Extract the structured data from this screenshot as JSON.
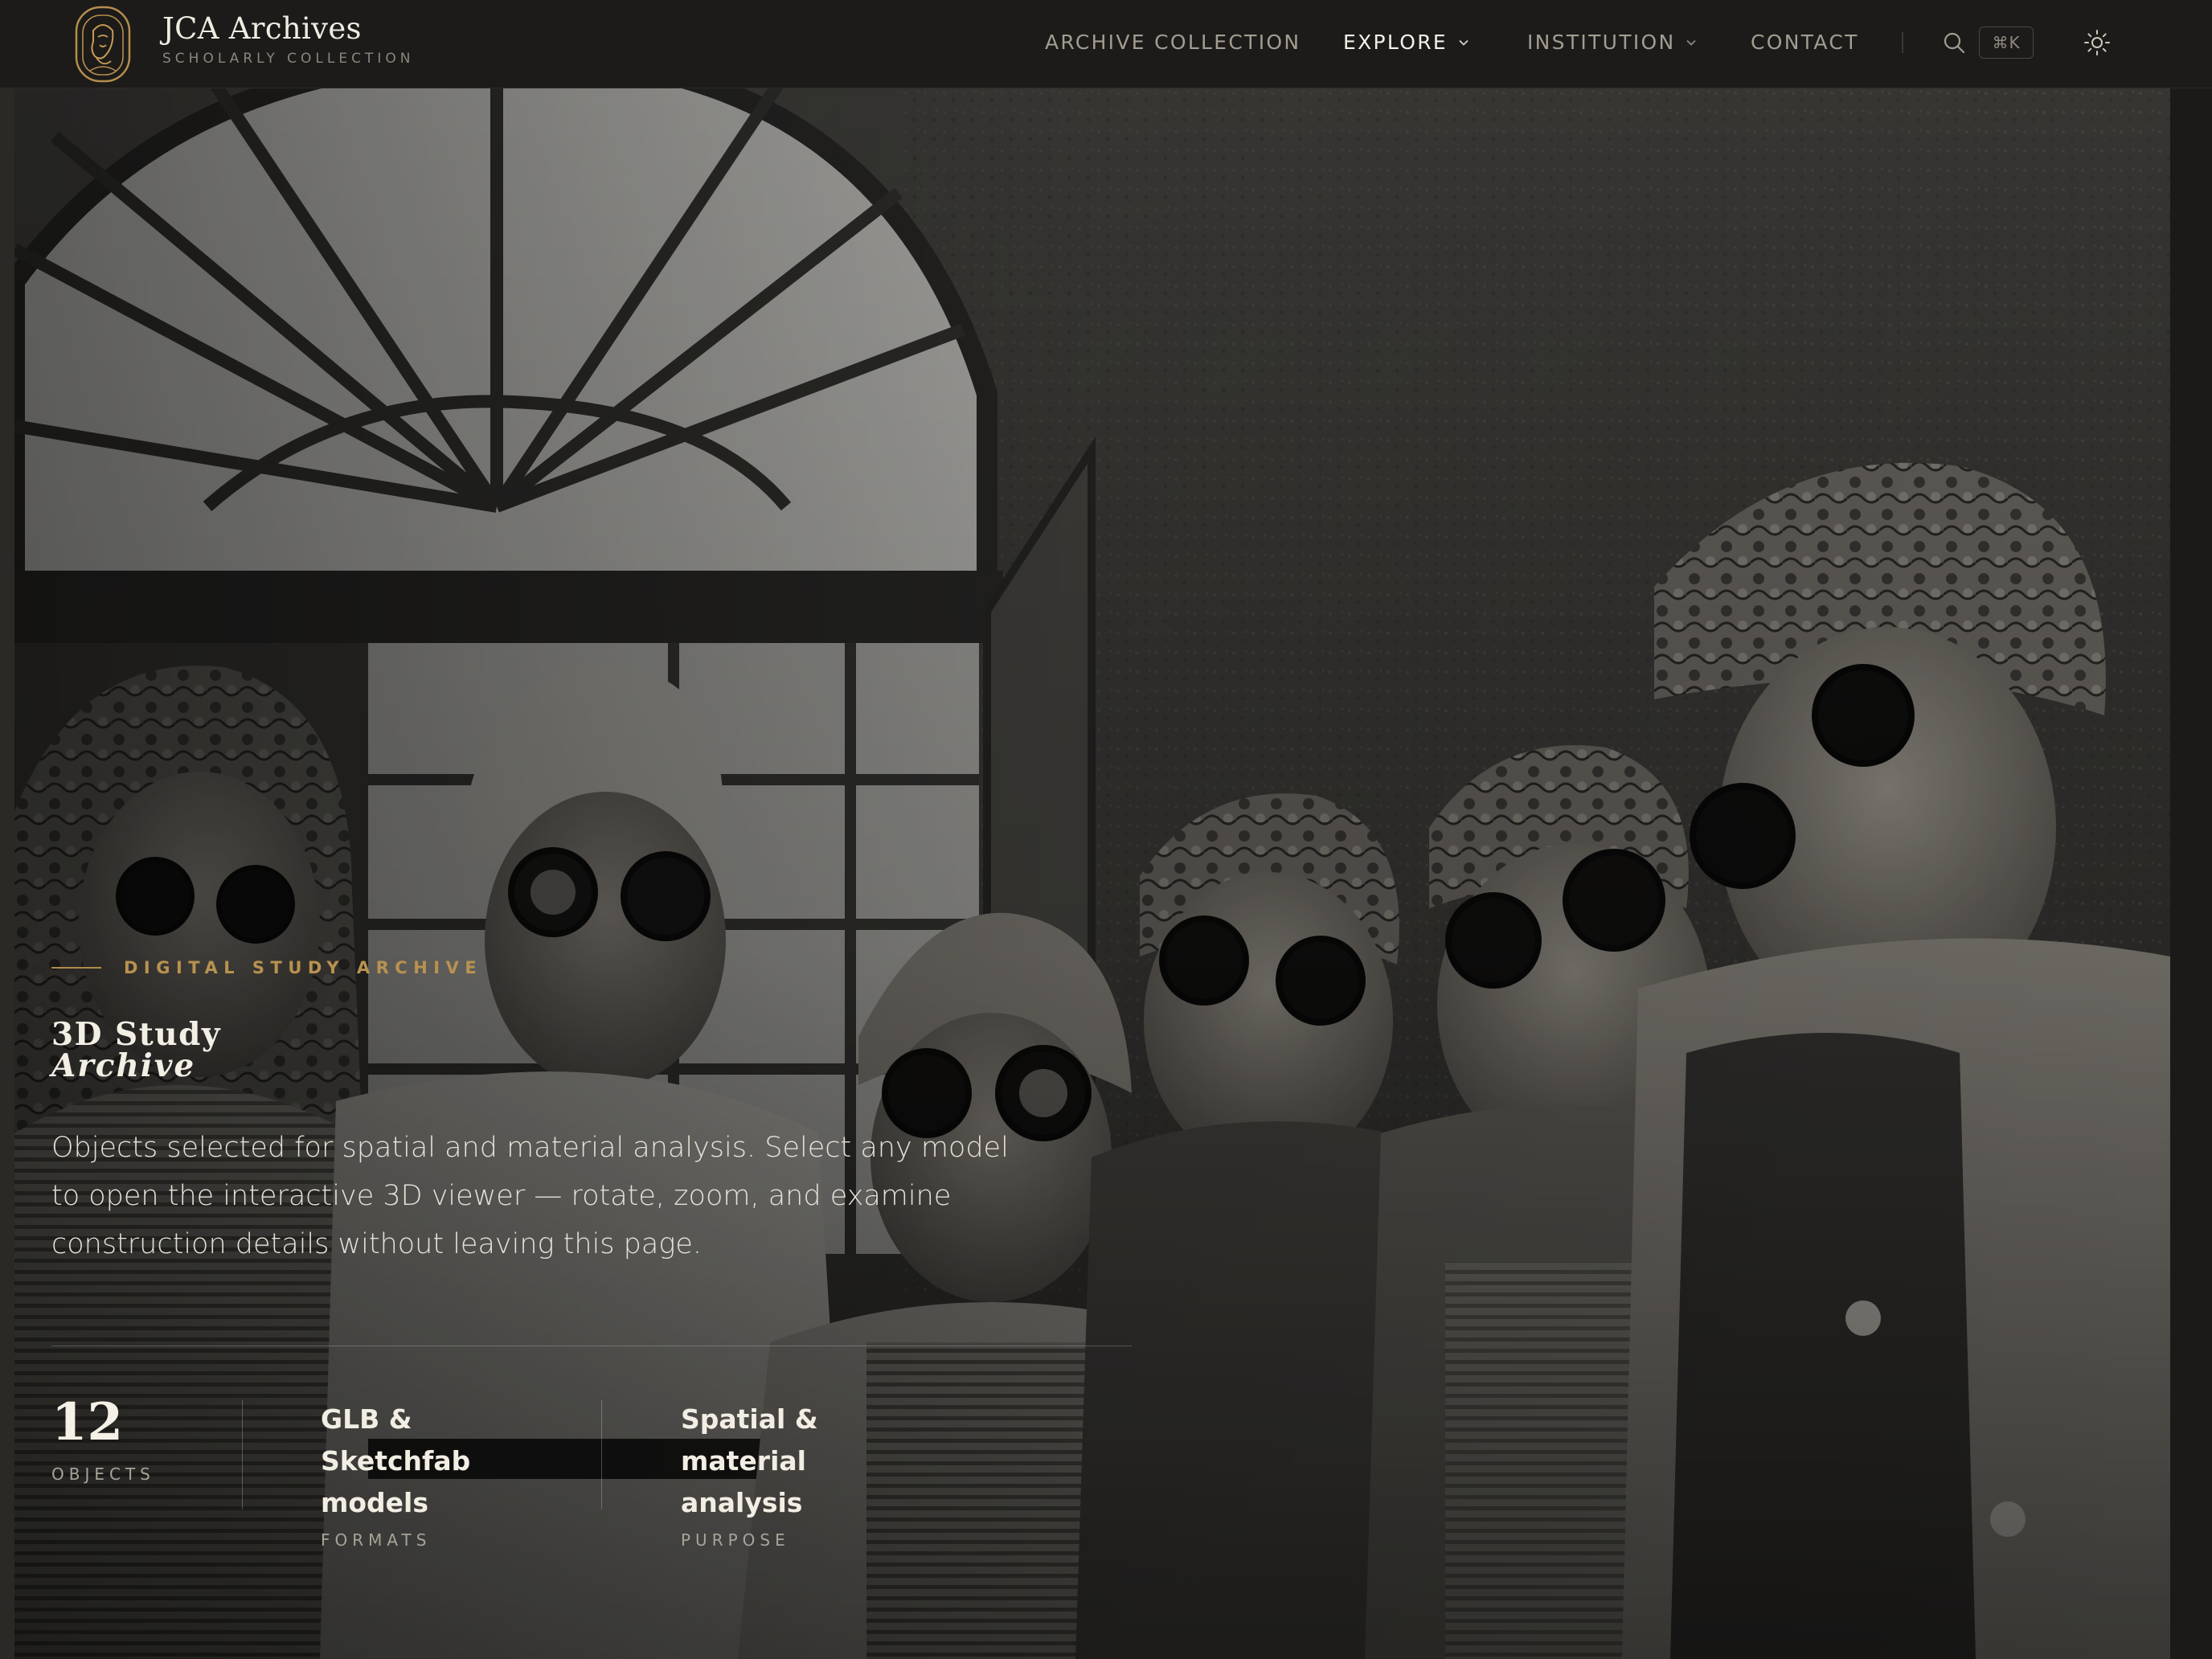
{
  "brand": {
    "title": "JCA Archives",
    "subtitle": "SCHOLARLY COLLECTION"
  },
  "nav": {
    "items": [
      {
        "label": "ARCHIVE COLLECTION",
        "active": false,
        "dropdown": false
      },
      {
        "label": "EXPLORE",
        "active": true,
        "dropdown": true
      },
      {
        "label": "INSTITUTION",
        "active": false,
        "dropdown": true
      },
      {
        "label": "CONTACT",
        "active": false,
        "dropdown": false
      }
    ],
    "search_shortcut": "⌘K",
    "icons": [
      "search-icon",
      "theme-toggle-sun-icon"
    ]
  },
  "hero": {
    "image_alt": "Black and white photograph of women in headscarves and welding goggles gathered around a workbench",
    "eyebrow": "DIGITAL STUDY ARCHIVE",
    "title_line1": "3D Study",
    "title_line2": "Archive",
    "description": "Objects selected for spatial and material analysis. Select any model to open the interactive 3D viewer — rotate, zoom, and examine construction details without leaving this page.",
    "stats": [
      {
        "value": "12",
        "label": "OBJECTS"
      },
      {
        "value": "GLB & Sketchfab models",
        "label": "FORMATS"
      },
      {
        "value": "Spatial & material analysis",
        "label": "PURPOSE"
      }
    ]
  },
  "colors": {
    "accent_gold": "#b8924f",
    "nav_bg": "#1c1b19",
    "text_light": "#f4efe5"
  }
}
